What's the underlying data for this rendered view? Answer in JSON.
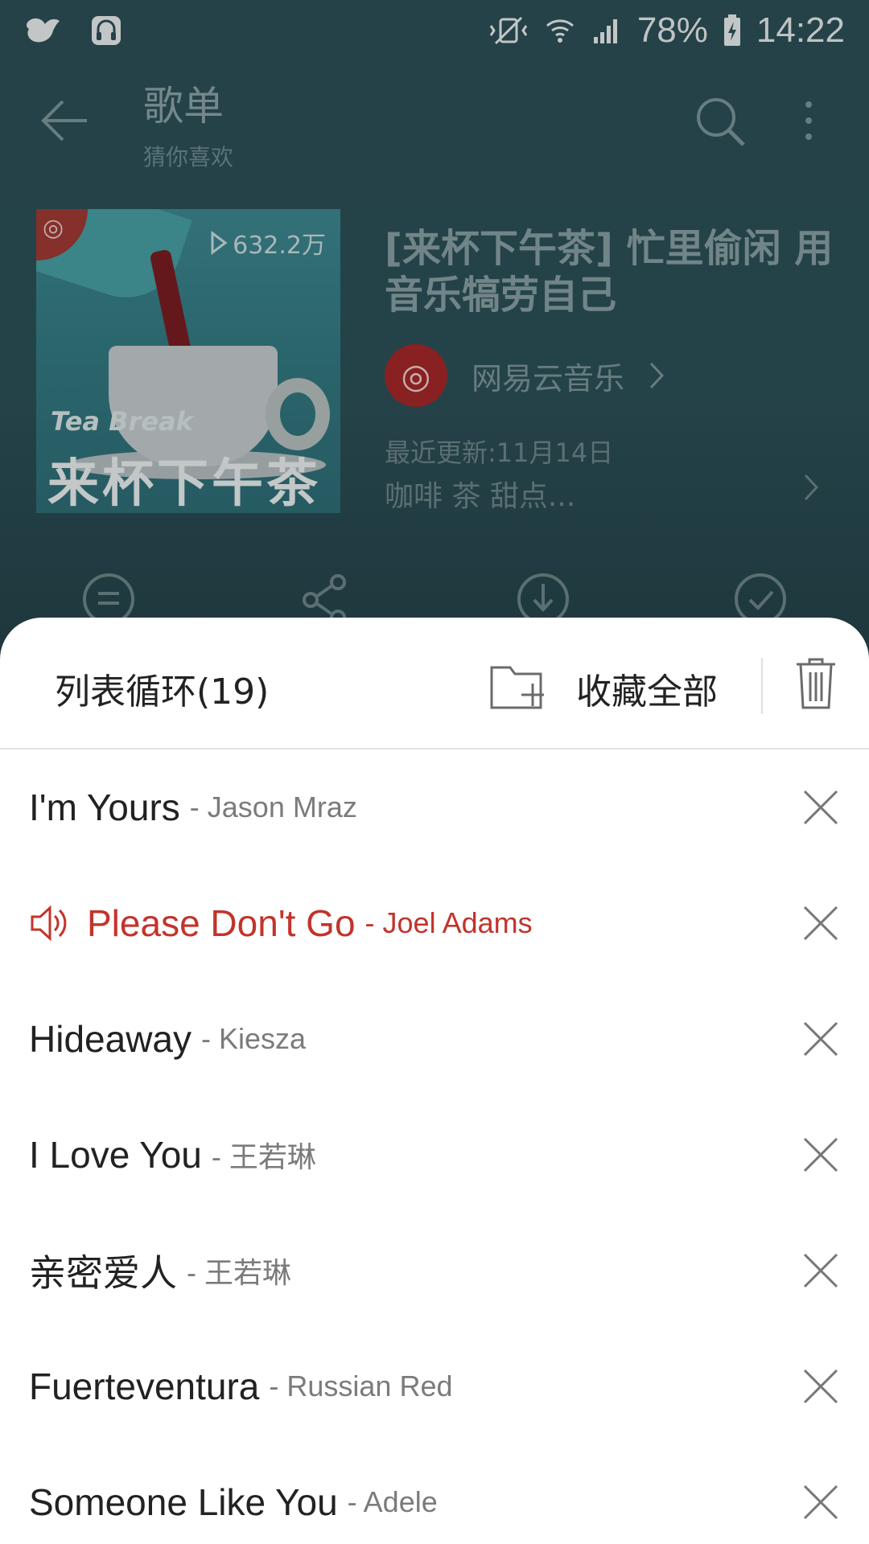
{
  "status_bar": {
    "battery": "78%",
    "time": "14:22"
  },
  "toolbar": {
    "title": "歌单",
    "subtitle": "猜你喜欢"
  },
  "playlist": {
    "play_count": "632.2万",
    "cover_text_en": "Tea Break",
    "cover_text_zh": "来杯下午茶",
    "title": "[来杯下午茶] 忙里偷闲 用音乐犒劳自己",
    "creator": "网易云音乐",
    "updated": "最近更新:11月14日",
    "tags": "咖啡 茶 甜点..."
  },
  "sheet": {
    "mode_label": "列表循环(19)",
    "collect_label": "收藏全部",
    "songs": [
      {
        "title": "I'm Yours",
        "artist": "- Jason Mraz",
        "playing": false
      },
      {
        "title": "Please Don't Go",
        "artist": "- Joel Adams",
        "playing": true
      },
      {
        "title": "Hideaway",
        "artist": "- Kiesza",
        "playing": false
      },
      {
        "title": "I Love You",
        "artist": "- 王若琳",
        "playing": false
      },
      {
        "title": "亲密爱人",
        "artist": "- 王若琳",
        "playing": false
      },
      {
        "title": "Fuerteventura",
        "artist": "- Russian Red",
        "playing": false
      },
      {
        "title": "Someone Like You",
        "artist": "- Adele",
        "playing": false
      }
    ]
  },
  "colors": {
    "accent": "#c2342b",
    "background": "#2c5158"
  }
}
